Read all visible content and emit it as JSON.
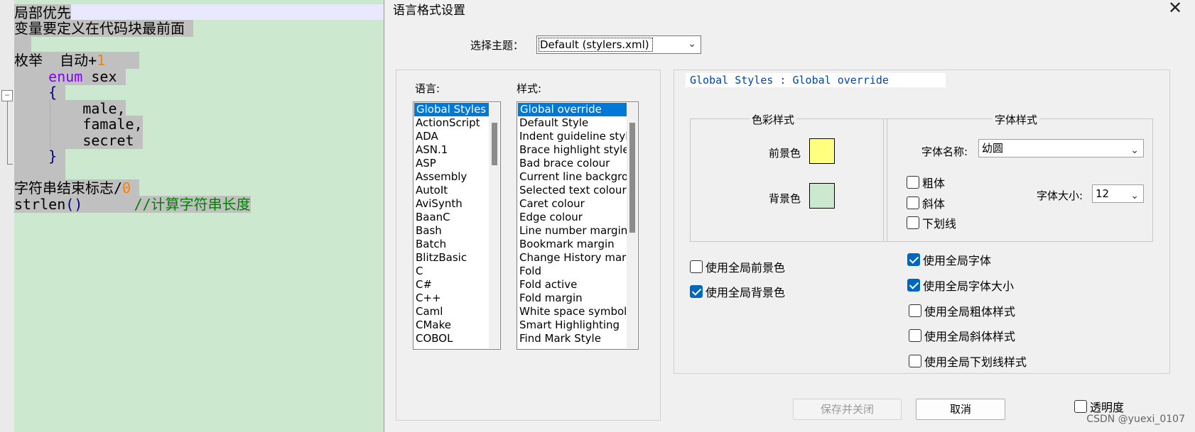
{
  "editor": {
    "lines": {
      "l1": "局部优先",
      "l2": "变量要定义在代码块最前面",
      "l3a": "枚举  自动+",
      "l3b": "1",
      "l4a": "enum",
      "l4b": " sex",
      "l5": "{",
      "l6": "male,",
      "l7": "famale,",
      "l8": "secret",
      "l9": "}",
      "l10a": "字符串结束标志/",
      "l10b": "0",
      "l11a": "strlen",
      "l11b": "()",
      "l11c": "//计算字符串长度"
    },
    "fold_symbol": "−"
  },
  "dialog": {
    "title": "语言格式设置",
    "close_label": "✕",
    "theme": {
      "label": "选择主题：",
      "value": "Default (stylers.xml)"
    },
    "language_label": "语言:",
    "style_label": "样式:",
    "languages": [
      "Global Styles",
      "ActionScript",
      "ADA",
      "ASN.1",
      "ASP",
      "Assembly",
      "AutoIt",
      "AviSynth",
      "BaanC",
      "Bash",
      "Batch",
      "BlitzBasic",
      "C",
      "C#",
      "C++",
      "Caml",
      "CMake",
      "COBOL"
    ],
    "styles": [
      "Global override",
      "Default Style",
      "Indent guideline style",
      "Brace highlight style",
      "Bad brace colour",
      "Current line background colour",
      "Selected text colour",
      "Caret colour",
      "Edge colour",
      "Line number margin",
      "Bookmark margin",
      "Change History margin",
      "Fold",
      "Fold active",
      "Fold margin",
      "White space symbol",
      "Smart Highlighting",
      "Find Mark Style"
    ],
    "global_header": "Global Styles : Global override",
    "color_style": {
      "title": "色彩样式",
      "fg_label": "前景色",
      "bg_label": "背景色",
      "fg_color": "#ffff80",
      "bg_color": "#cce8cf"
    },
    "font_style": {
      "title": "字体样式",
      "font_name_label": "字体名称:",
      "font_name_value": "幼圆",
      "bold": "粗体",
      "italic": "斜体",
      "underline": "下划线",
      "size_label": "字体大小:",
      "size_value": "12"
    },
    "checks_left": {
      "use_global_fg": "使用全局前景色",
      "use_global_bg": "使用全局背景色"
    },
    "checks_right": {
      "use_global_font": "使用全局字体",
      "use_global_font_size": "使用全局字体大小",
      "use_global_bold": "使用全局粗体样式",
      "use_global_italic": "使用全局斜体样式",
      "use_global_underline": "使用全局下划线样式"
    },
    "save_close": "保存并关闭",
    "cancel": "取消",
    "transparency": "透明度"
  },
  "watermark": "CSDN @yuexi_0107"
}
